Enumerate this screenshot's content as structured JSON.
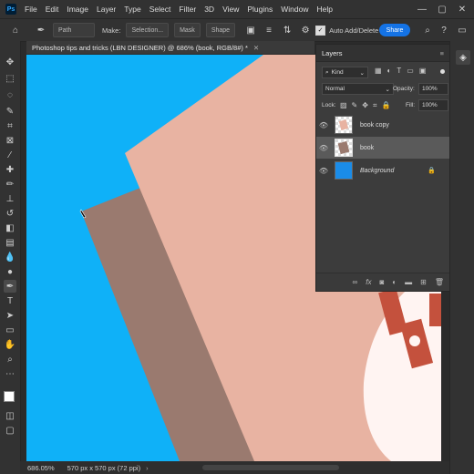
{
  "app": {
    "logo": "Ps",
    "menus": [
      "File",
      "Edit",
      "Image",
      "Layer",
      "Type",
      "Select",
      "Filter",
      "3D",
      "View",
      "Plugins",
      "Window",
      "Help"
    ],
    "window_controls": [
      "—",
      "▢",
      "✕"
    ]
  },
  "options_bar": {
    "mode": "Path",
    "make_label": "Make:",
    "selection": "Selection...",
    "mask": "Mask",
    "shape": "Shape",
    "auto_add_delete": "Auto Add/Delete",
    "share": "Share"
  },
  "document": {
    "tab_title": "Photoshop tips and tricks (LBN DESIGNER) @ 686% (book, RGB/8#) *",
    "zoom": "686.05%",
    "dimensions": "570 px x 570 px (72 ppi)"
  },
  "layers_panel": {
    "title": "Layers",
    "filter": "Kind",
    "blend_mode": "Normal",
    "opacity_label": "Opacity:",
    "opacity": "100%",
    "lock_label": "Lock:",
    "fill_label": "Fill:",
    "fill": "100%",
    "layers": [
      {
        "name": "book copy",
        "selected": false
      },
      {
        "name": "book",
        "selected": true
      },
      {
        "name": "Background",
        "selected": false,
        "locked": true
      }
    ],
    "footer_icons": [
      "link-icon",
      "fx-icon",
      "mask-icon",
      "adjustment-icon",
      "folder-icon",
      "new-layer-icon",
      "trash-icon"
    ]
  },
  "colors": {
    "canvas_bg": "#0fb1f8",
    "paper_front": "#e8b3a2",
    "paper_back": "#9a7a6f",
    "accent": "#1473e6"
  }
}
